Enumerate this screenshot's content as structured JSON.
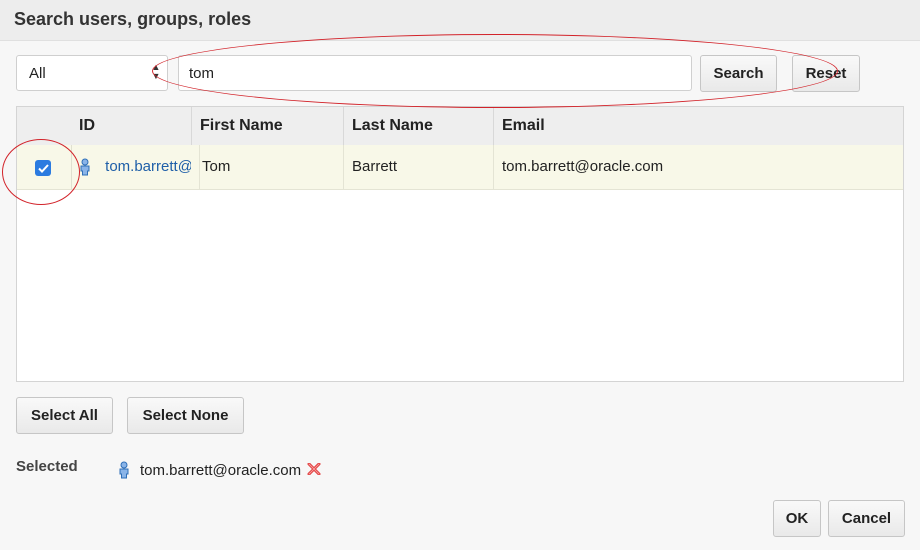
{
  "dialog": {
    "title": "Search users, groups, roles"
  },
  "search": {
    "scope_value": "All",
    "query": "tom",
    "search_label": "Search",
    "reset_label": "Reset"
  },
  "table": {
    "columns": {
      "id": "ID",
      "first_name": "First Name",
      "last_name": "Last Name",
      "email": "Email"
    },
    "rows": [
      {
        "checked": true,
        "id": "tom.barrett@oracle.com",
        "id_display": "tom.barrett@",
        "first_name": "Tom",
        "last_name": "Barrett",
        "email": "tom.barrett@oracle.com"
      }
    ]
  },
  "actions": {
    "select_all_label": "Select All",
    "select_none_label": "Select None"
  },
  "selected": {
    "label": "Selected",
    "items": [
      "tom.barrett@oracle.com"
    ]
  },
  "footer": {
    "ok_label": "OK",
    "cancel_label": "Cancel"
  },
  "colors": {
    "checkbox": "#2b7be0",
    "link": "#1f5fa8",
    "annotation": "#d2232a",
    "row_highlight": "#f8f8e8"
  },
  "icons": {
    "user": "user-icon",
    "remove": "remove-icon",
    "check": "check-icon",
    "select_arrows": "up-down-arrows-icon"
  }
}
